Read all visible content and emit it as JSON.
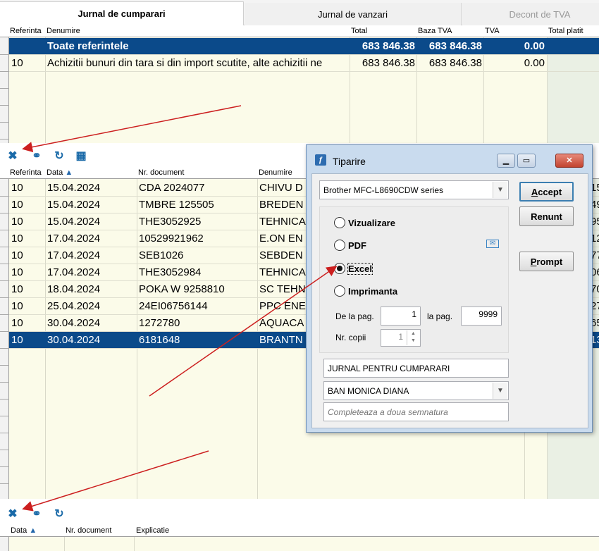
{
  "tabs": [
    "Jurnal de cumparari",
    "Jurnal de vanzari",
    "Decont de TVA"
  ],
  "summary_grid": {
    "columns": [
      "Referinta",
      "Denumire",
      "Total",
      "Baza TVA",
      "TVA",
      "Total platit"
    ],
    "rows": [
      {
        "ref": "",
        "name": "Toate referintele",
        "total": "683 846.38",
        "baza": "683 846.38",
        "tva": "0.00",
        "platit": ""
      },
      {
        "ref": "10",
        "name": "Achizitii bunuri din tara si din import scutite, alte achizitii ne",
        "total": "683 846.38",
        "baza": "683 846.38",
        "tva": "0.00",
        "platit": ""
      }
    ]
  },
  "toolbar_icons": [
    "excel-export-icon",
    "binoculars-icon",
    "refresh-icon",
    "calculator-icon"
  ],
  "documents_grid": {
    "columns": [
      "Referinta",
      "Data",
      "Nr. document",
      "Denumire"
    ],
    "rows": [
      {
        "ref": "10",
        "date": "15.04.2024",
        "doc": "CDA 2024077",
        "name": "CHIVU D",
        "tail": "15"
      },
      {
        "ref": "10",
        "date": "15.04.2024",
        "doc": "TMBRE 125505",
        "name": "BREDEN",
        "tail": "49"
      },
      {
        "ref": "10",
        "date": "15.04.2024",
        "doc": "THE3052925",
        "name": "TEHNICA",
        "tail": "95"
      },
      {
        "ref": "10",
        "date": "17.04.2024",
        "doc": "10529921962",
        "name": "E.ON EN",
        "tail": "12"
      },
      {
        "ref": "10",
        "date": "17.04.2024",
        "doc": "SEB1026",
        "name": "SEBDEN",
        "tail": "77"
      },
      {
        "ref": "10",
        "date": "17.04.2024",
        "doc": "THE3052984",
        "name": "TEHNICA",
        "tail": "06"
      },
      {
        "ref": "10",
        "date": "18.04.2024",
        "doc": "POKA W 9258810",
        "name": "SC TEHN",
        "tail": "70"
      },
      {
        "ref": "10",
        "date": "25.04.2024",
        "doc": "24EI06756144",
        "name": "PPC ENE",
        "tail": "27"
      },
      {
        "ref": "10",
        "date": "30.04.2024",
        "doc": "1272780",
        "name": "AQUACA",
        "tail": "65"
      },
      {
        "ref": "10",
        "date": "30.04.2024",
        "doc": "6181648",
        "name": "BRANTN",
        "tail": "13"
      }
    ],
    "selected_index": 9
  },
  "bottom_grid": {
    "columns": [
      "Data",
      "Nr. document",
      "Explicatie"
    ]
  },
  "dialog": {
    "title": "Tiparire",
    "printer": "Brother MFC-L8690CDW series",
    "buttons": {
      "accept": "Accept",
      "cancel": "Renunt",
      "prompt": "Prompt"
    },
    "options": [
      "Vizualizare",
      "PDF",
      "Excel",
      "Imprimanta"
    ],
    "selected_option": "Excel",
    "from_page_label": "De la pag.",
    "from_page": "1",
    "to_page_label": "la pag.",
    "to_page": "9999",
    "copies_label": "Nr. copii",
    "copies": "1",
    "report_title": "JURNAL PENTRU CUMPARARI",
    "signature": "BAN MONICA DIANA",
    "second_signature_placeholder": "Completeaza a doua semnatura"
  },
  "colors": {
    "selection": "#0b4a8a",
    "grid_bg": "#fbfbe9",
    "dialog_frame": "#c9dbee",
    "annotation_arrow": "#cc1f1f"
  }
}
